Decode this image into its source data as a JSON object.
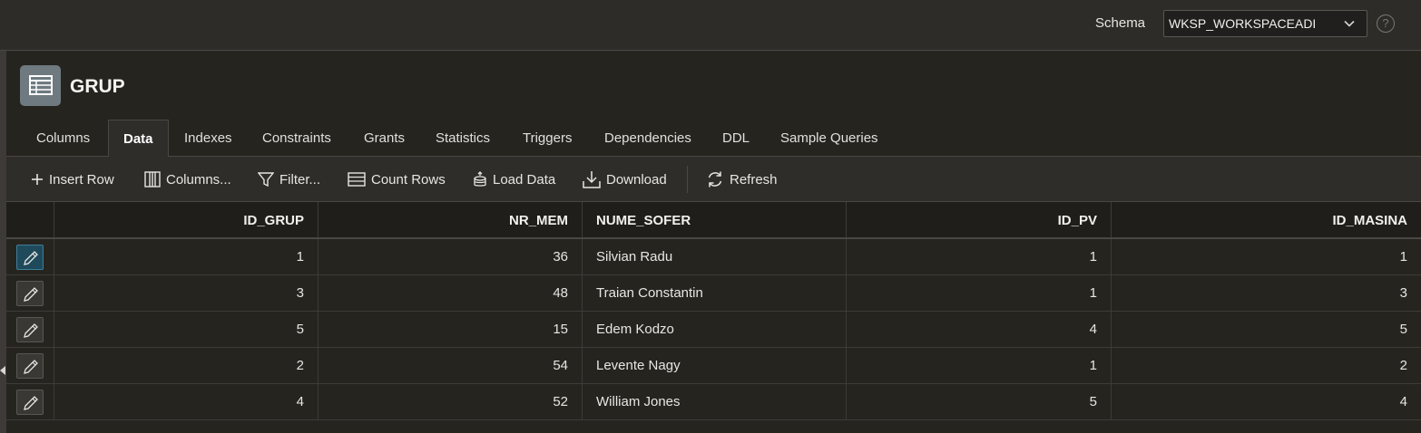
{
  "topbar": {
    "schema_label": "Schema",
    "schema_value": "WKSP_WORKSPACEADI",
    "help_glyph": "?"
  },
  "object": {
    "title": "GRUP",
    "icon": "table-icon"
  },
  "tabs": [
    {
      "label": "Columns"
    },
    {
      "label": "Data",
      "active": true
    },
    {
      "label": "Indexes"
    },
    {
      "label": "Constraints"
    },
    {
      "label": "Grants"
    },
    {
      "label": "Statistics"
    },
    {
      "label": "Triggers"
    },
    {
      "label": "Dependencies"
    },
    {
      "label": "DDL"
    },
    {
      "label": "Sample Queries"
    }
  ],
  "toolbar": {
    "insert_row": "Insert Row",
    "columns": "Columns...",
    "filter": "Filter...",
    "count_rows": "Count Rows",
    "load_data": "Load Data",
    "download": "Download",
    "refresh": "Refresh"
  },
  "grid": {
    "headers": [
      "ID_GRUP",
      "NR_MEM",
      "NUME_SOFER",
      "ID_PV",
      "ID_MASINA"
    ],
    "rows": [
      {
        "id_grup": "1",
        "nr_mem": "36",
        "nume_sofer": "Silvian Radu",
        "id_pv": "1",
        "id_masina": "1"
      },
      {
        "id_grup": "3",
        "nr_mem": "48",
        "nume_sofer": "Traian Constantin",
        "id_pv": "1",
        "id_masina": "3"
      },
      {
        "id_grup": "5",
        "nr_mem": "15",
        "nume_sofer": "Edem Kodzo",
        "id_pv": "4",
        "id_masina": "5"
      },
      {
        "id_grup": "2",
        "nr_mem": "54",
        "nume_sofer": "Levente Nagy",
        "id_pv": "1",
        "id_masina": "2"
      },
      {
        "id_grup": "4",
        "nr_mem": "52",
        "nume_sofer": "William Jones",
        "id_pv": "5",
        "id_masina": "4"
      }
    ]
  },
  "colors": {
    "accent_focus": "#1f4a5c",
    "background": "#26241f",
    "header_bg": "#201e1b"
  }
}
